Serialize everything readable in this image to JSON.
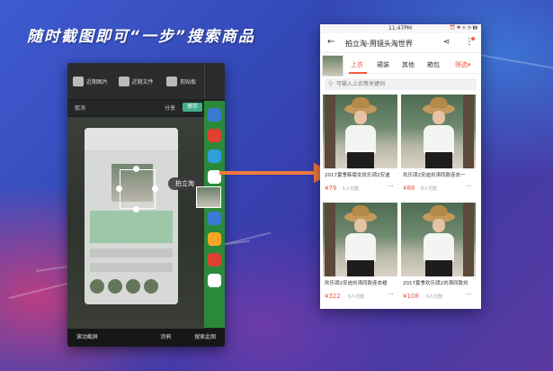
{
  "slogan": "随时截图即可“一步”搜索商品",
  "left_panel": {
    "tools": [
      {
        "label": "近期图片",
        "icon": "image-icon"
      },
      {
        "label": "近期文件",
        "icon": "file-icon"
      },
      {
        "label": "剪贴板",
        "icon": "scissors-icon"
      }
    ],
    "cancel_label": "取消",
    "share_label": "分享",
    "save_label": "保存",
    "popup_label": "拍立淘",
    "bottom_actions": [
      "滚动截屏",
      "",
      "涂鸦",
      "搜索此图"
    ]
  },
  "phone": {
    "status_time": "11:47PM",
    "status_icons": "⏰ ✱ ≋ ◔ ▮▮",
    "title": "拍立淘-用镜头淘世界",
    "tabs": [
      "上衣",
      "裙装",
      "其他",
      "箱包"
    ],
    "active_tab_index": 0,
    "filter_label": "筛选▾",
    "search_placeholder": "可输入上衣等关键词",
    "accent_color": "#f25a3a",
    "products": [
      {
        "desc": "2017夏季韩版女欢乐颂2安迪",
        "price": "79",
        "sold": "1人付款"
      },
      {
        "desc": "欢乐颂2安迪刘涛同款连衣一",
        "price": "88",
        "sold": "0人付款"
      },
      {
        "desc": "欢乐颂2安迪刘涛同款连衣裙",
        "price": "322",
        "sold": "0人付款"
      },
      {
        "desc": "2017夏季欢乐颂2刘涛同款刘",
        "price": "108",
        "sold": "0人付款"
      }
    ]
  }
}
